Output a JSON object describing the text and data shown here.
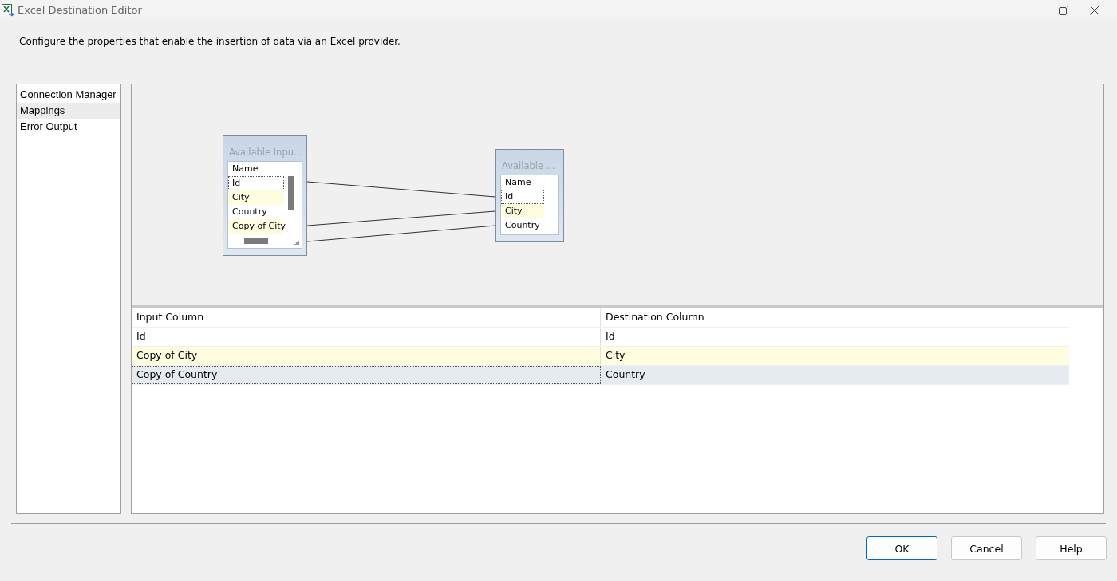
{
  "window": {
    "title": "Excel Destination Editor"
  },
  "description": "Configure the properties that enable the insertion of data via an Excel provider.",
  "sidebar": {
    "items": [
      {
        "label": "Connection Manager",
        "selected": false
      },
      {
        "label": "Mappings",
        "selected": true
      },
      {
        "label": "Error Output",
        "selected": false
      }
    ]
  },
  "diagram": {
    "input_box": {
      "title": "Available Inpu...",
      "header": "Name",
      "rows": [
        "Id",
        "City",
        "Country",
        "Copy of City"
      ]
    },
    "destination_box": {
      "title": "Available ...",
      "header": "Name",
      "rows": [
        "Id",
        "City",
        "Country"
      ]
    }
  },
  "table": {
    "columns": [
      "Input Column",
      "Destination Column"
    ],
    "rows": [
      {
        "cells": [
          "Id",
          "Id"
        ],
        "selected": false
      },
      {
        "cells": [
          "Copy of City",
          "City"
        ],
        "selected": false
      },
      {
        "cells": [
          "Copy of Country",
          "Country"
        ],
        "selected": true
      }
    ]
  },
  "buttons": [
    "OK",
    "Cancel",
    "Help"
  ]
}
